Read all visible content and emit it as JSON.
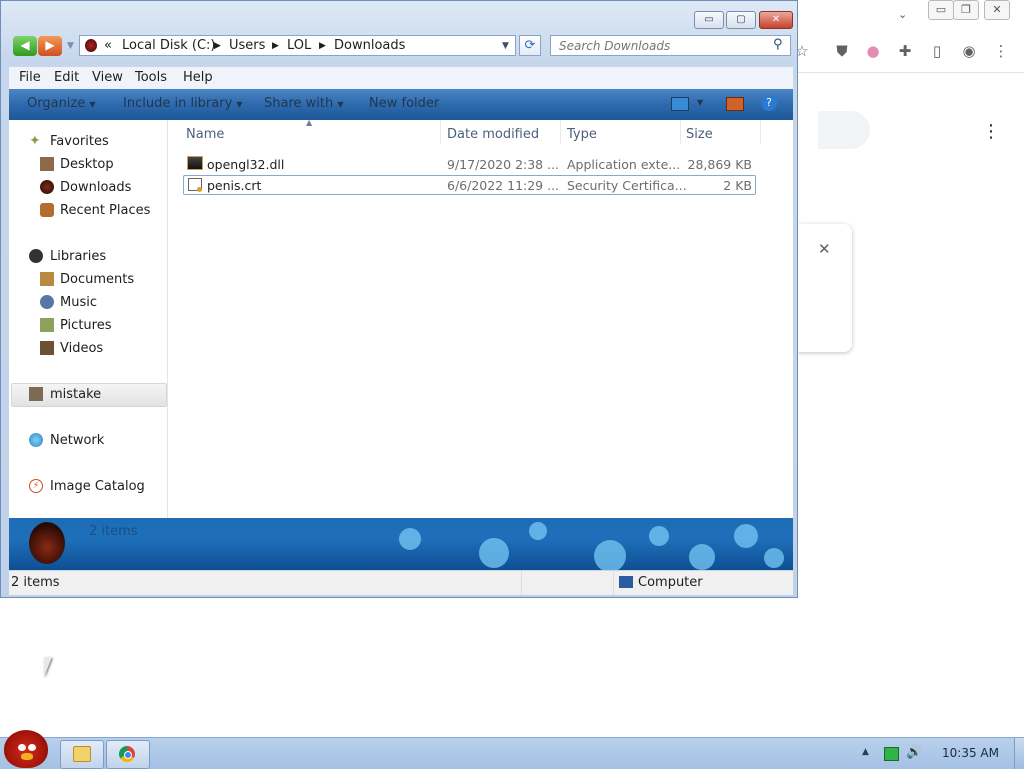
{
  "explorer": {
    "address": {
      "overflow": "«",
      "crumbs": [
        "Local Disk (C:)",
        "Users",
        "LOL",
        "Downloads"
      ]
    },
    "search_placeholder": "Search Downloads",
    "window_buttons": {
      "minimize": "▭",
      "maximize": "▢",
      "close": "✕"
    },
    "menu": [
      "File",
      "Edit",
      "View",
      "Tools",
      "Help"
    ],
    "commands": [
      "Organize",
      "Include in library",
      "Share with",
      "New folder"
    ],
    "nav": {
      "favorites": {
        "label": "Favorites",
        "items": [
          "Desktop",
          "Downloads",
          "Recent Places"
        ]
      },
      "libraries": {
        "label": "Libraries",
        "items": [
          "Documents",
          "Music",
          "Pictures",
          "Videos"
        ]
      },
      "mistake": "mistake",
      "network": "Network",
      "image_catalog": "Image Catalog"
    },
    "columns": [
      "Name",
      "Date modified",
      "Type",
      "Size"
    ],
    "files": [
      {
        "name": "opengl32.dll",
        "date": "9/17/2020 2:38 ...",
        "type": "Application exte...",
        "size": "28,869 KB"
      },
      {
        "name": "penis.crt",
        "date": "6/6/2022 11:29 ...",
        "type": "Security Certifica...",
        "size": "2 KB"
      }
    ],
    "details_text": "2 items",
    "status_left": "2 items",
    "status_right": "Computer"
  },
  "taskbar": {
    "clock": "10:35 AM"
  },
  "colors": {
    "accent": "#2d6aad",
    "details_bg": "#1e6fba",
    "selection_border": "#8aa7cc"
  }
}
